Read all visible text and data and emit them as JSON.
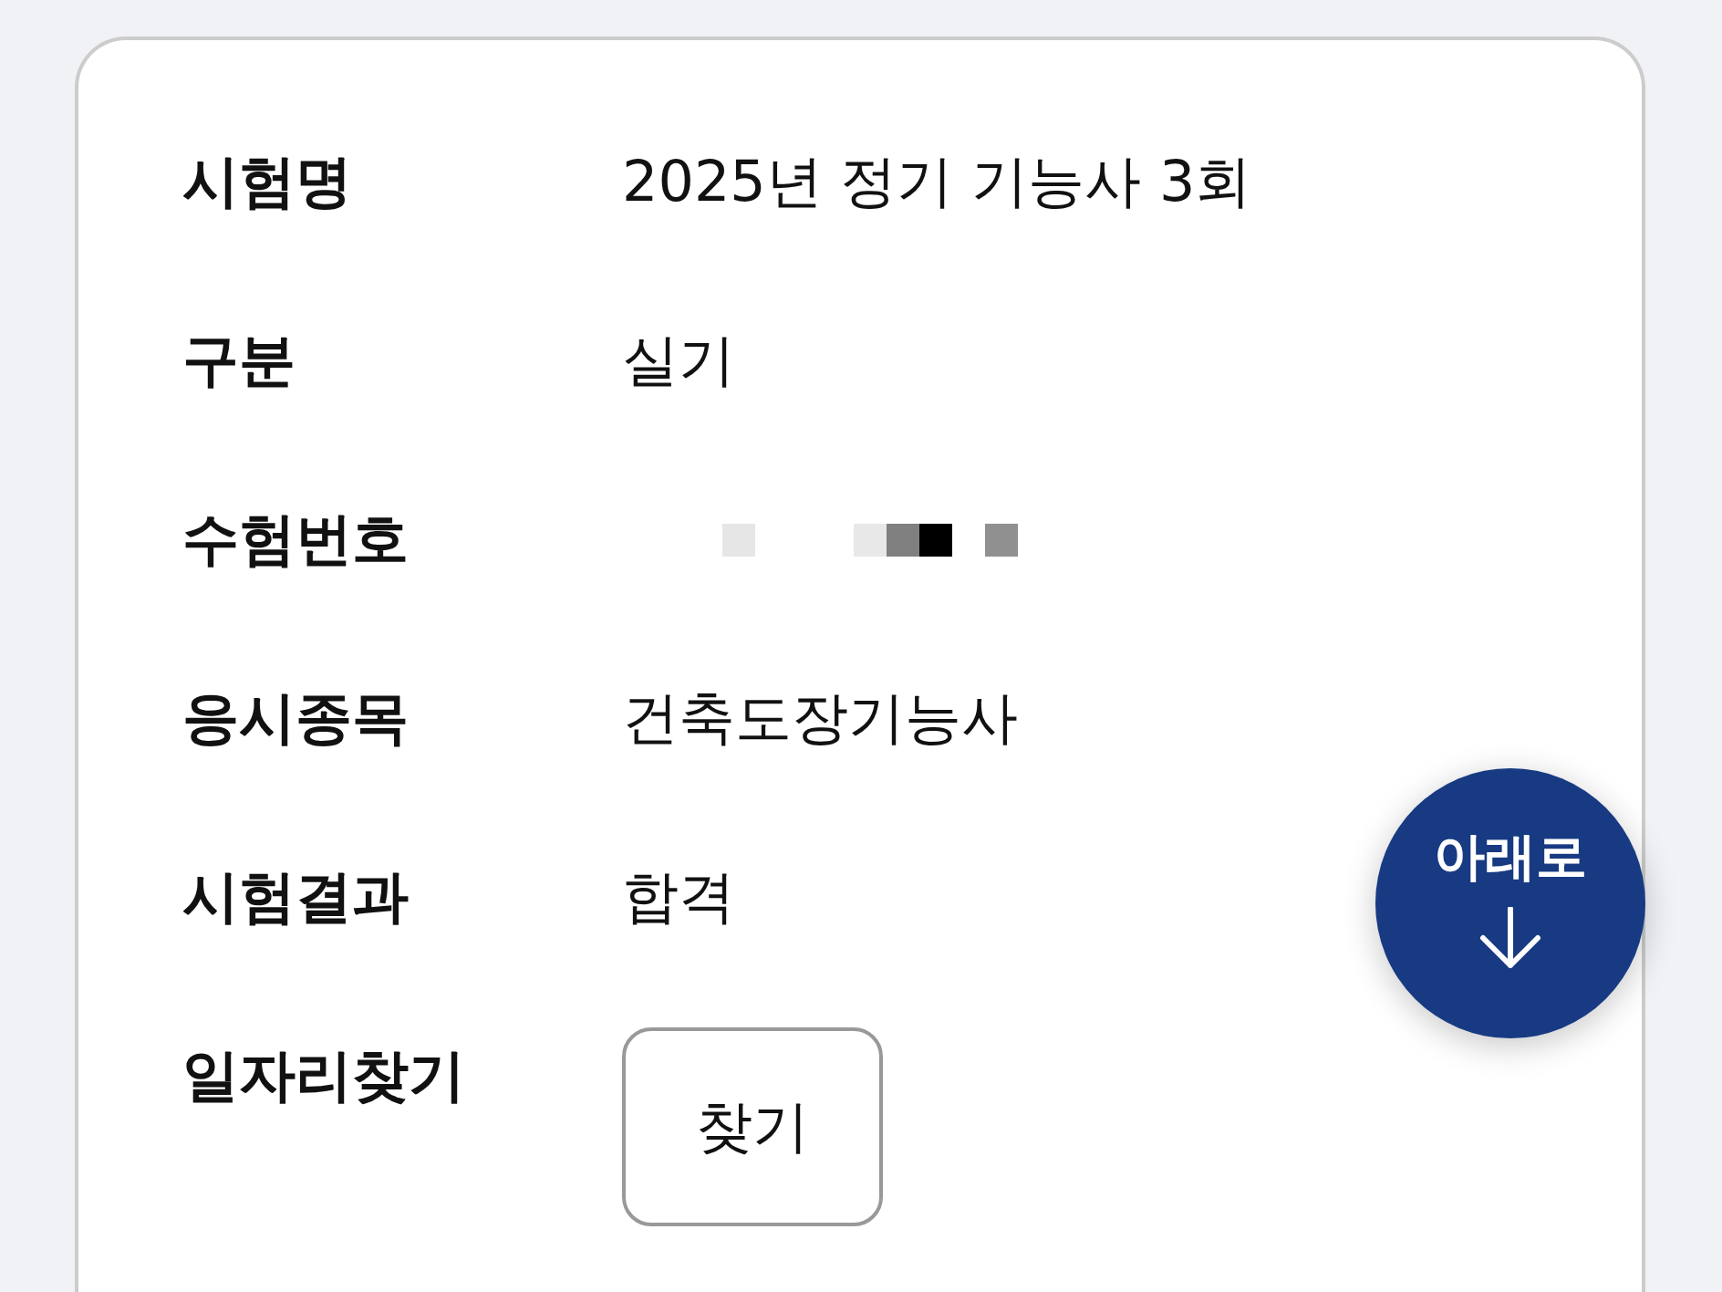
{
  "card": {
    "rows": [
      {
        "kind": "text",
        "label": "시험명",
        "value": "2025년 정기 기능사 3회"
      },
      {
        "kind": "text",
        "label": "구분",
        "value": "실기"
      },
      {
        "kind": "redacted",
        "label": "수험번호"
      },
      {
        "kind": "text",
        "label": "응시종목",
        "value": "건축도장기능사"
      },
      {
        "kind": "text",
        "label": "시험결과",
        "value": "합격"
      },
      {
        "kind": "button",
        "label": "일자리찾기",
        "button": "찾기"
      }
    ]
  },
  "floating_button": {
    "label": "아래로"
  }
}
